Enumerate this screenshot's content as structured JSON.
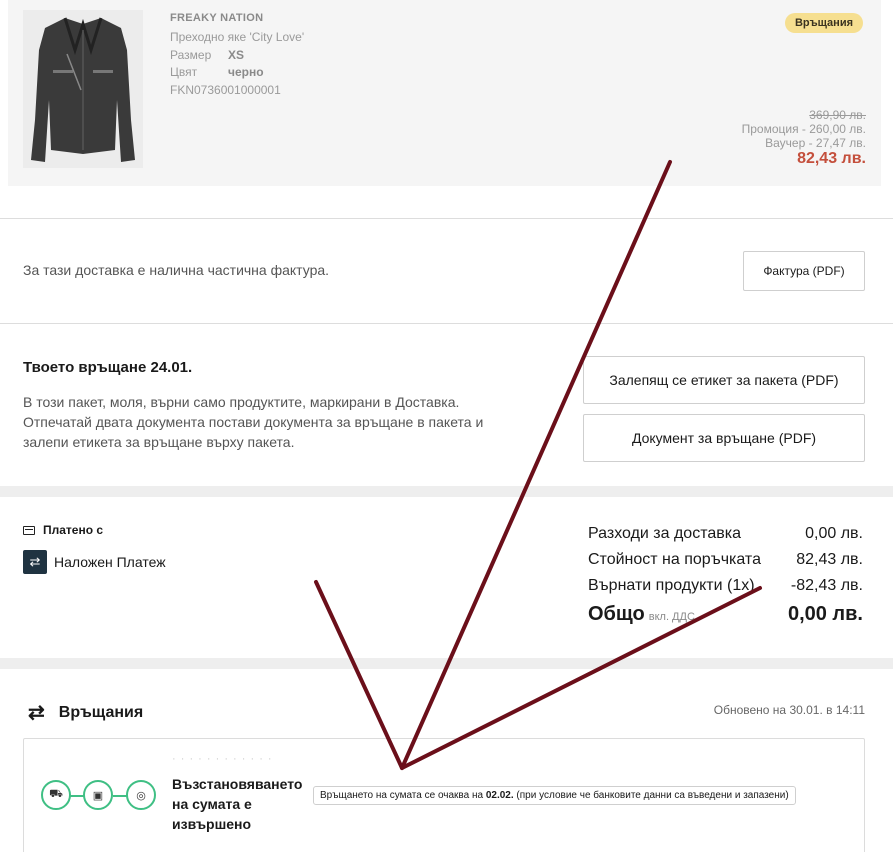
{
  "product": {
    "brand": "FREAKY NATION",
    "name": "Преходно яке 'City Love'",
    "size_label": "Размер",
    "size_value": "XS",
    "color_label": "Цвят",
    "color_value": "черно",
    "sku": "FKN0736001000001",
    "badge": "Връщания",
    "price_old": "369,90 лв.",
    "promotion": "Промоция - 260,00 лв.",
    "voucher": "Ваучер - 27,47 лв.",
    "price_final": "82,43 лв."
  },
  "invoice": {
    "text": "За тази доставка е налична частична фактура.",
    "button": "Фактура (PDF)"
  },
  "return_info": {
    "title": "Твоето връщане 24.01.",
    "description": "В този пакет, моля, върни само продуктите, маркирани в Доставка. Отпечатай двата документа постави документа за връщане в пакета и залепи етикета за връщане върху пакета.",
    "label_button": "Залепящ се етикет за пакета (PDF)",
    "document_button": "Документ за връщане (PDF)"
  },
  "payment": {
    "paid_with_label": "Платено с",
    "method": "Наложен Платеж"
  },
  "summary": {
    "rows": [
      {
        "label": "Разходи за доставка",
        "value": "0,00 лв."
      },
      {
        "label": "Стойност на поръчката",
        "value": "82,43 лв."
      },
      {
        "label": "Върнати продукти (1x)",
        "value": "-82,43 лв."
      }
    ],
    "total_label": "Общо",
    "total_incl": "вкл. ДДС",
    "total_value": "0,00 лв."
  },
  "returns": {
    "title": "Връщания",
    "updated": "Обновено на 30.01. в 14:11",
    "card": {
      "status": "Възстановяването на сумата е извършено",
      "tooltip_prefix": "Връщането на сумата се очаква на ",
      "tooltip_date": "02.02.",
      "tooltip_suffix": " (при условие че банковите данни са въведени и запазени)",
      "steps": [
        "truck-icon",
        "package-icon",
        "coins-icon"
      ]
    }
  },
  "annotation_color": "#6b0f1a"
}
